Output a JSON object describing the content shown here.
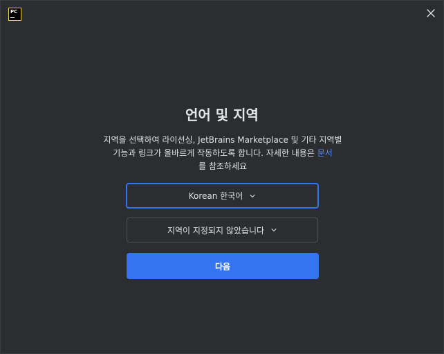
{
  "app": {
    "logo_text": "PC",
    "logo_color": "#f3d94a"
  },
  "dialog": {
    "title": "언어 및 지역",
    "description_line1": "지역을 선택하여 라이선싱, JetBrains Marketplace 및 기타 지역별",
    "description_line2_prefix": "기능과 링크가 올바르게 작동하도록 합니다. 자세한 내용은 ",
    "description_link": "문서",
    "description_line3": "를 참조하세요",
    "language_select": {
      "value": "Korean 한국어"
    },
    "region_select": {
      "value": "지역이 지정되지 않았습니다"
    },
    "next_button_label": "다음"
  },
  "colors": {
    "background": "#2b2d30",
    "accent": "#3574f0",
    "link": "#548af7",
    "text": "#dfe1e5"
  }
}
